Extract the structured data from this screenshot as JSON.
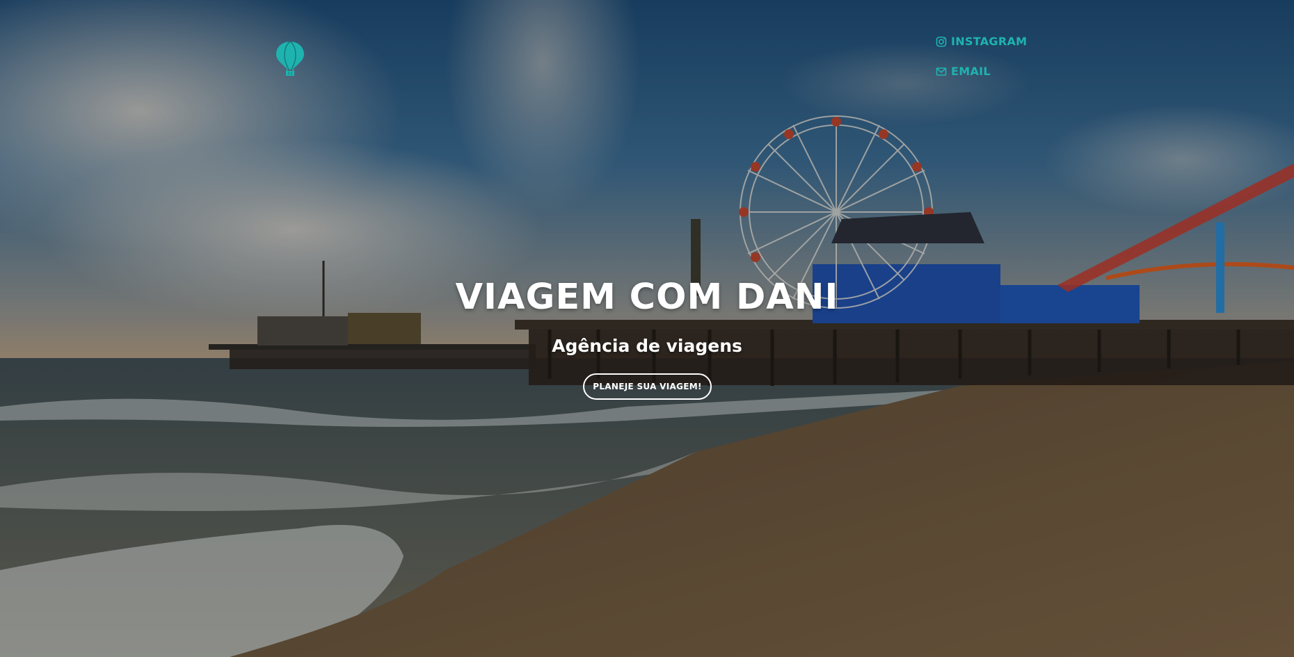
{
  "brand": {
    "logo_icon": "hot-air-balloon-icon",
    "accent_color": "#1fb3b0"
  },
  "social": {
    "items": [
      {
        "label": "INSTAGRAM",
        "icon": "instagram-icon"
      },
      {
        "label": "EMAIL",
        "icon": "envelope-icon"
      }
    ]
  },
  "hero": {
    "title": "VIAGEM COM DANI",
    "subtitle": "Agência de viagens",
    "cta_label": "PLANEJE SUA VIAGEM!"
  }
}
